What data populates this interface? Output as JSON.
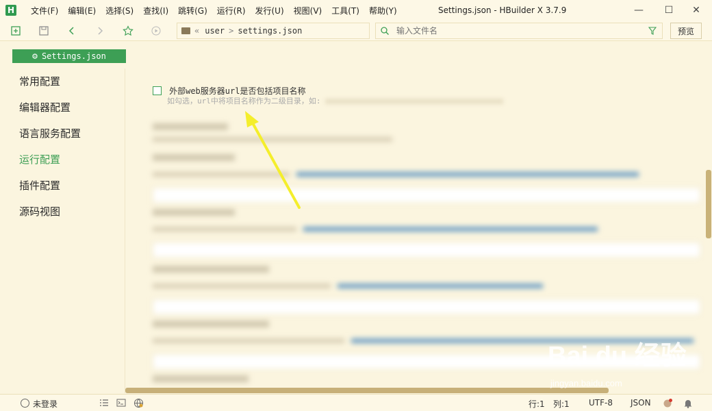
{
  "app": {
    "logo": "H",
    "window_title": "Settings.json - HBuilder X 3.7.9"
  },
  "menu": [
    "文件(F)",
    "编辑(E)",
    "选择(S)",
    "查找(I)",
    "跳转(G)",
    "运行(R)",
    "发行(U)",
    "视图(V)",
    "工具(T)",
    "帮助(Y)"
  ],
  "window_controls": {
    "minimize": "—",
    "maximize": "☐",
    "close": "✕"
  },
  "toolbar": {
    "breadcrumb": {
      "prefix": "«",
      "parts": [
        "user",
        "settings.json"
      ],
      "separator": ">"
    },
    "search_placeholder": "输入文件名",
    "preview_label": "预览"
  },
  "tab": {
    "label": "Settings.json",
    "accent": "#3d9f55"
  },
  "sidebar": {
    "items": [
      {
        "label": "常用配置",
        "active": false
      },
      {
        "label": "编辑器配置",
        "active": false
      },
      {
        "label": "语言服务配置",
        "active": false
      },
      {
        "label": "运行配置",
        "active": true
      },
      {
        "label": "插件配置",
        "active": false
      },
      {
        "label": "源码视图",
        "active": false
      }
    ]
  },
  "main": {
    "option": {
      "label": "外部web服务器url是否包括项目名称",
      "description": "如勾选，url中将项目名称作为二级目录，如:",
      "checked": false
    }
  },
  "statusbar": {
    "login": "未登录",
    "line": "行:1",
    "col": "列:1",
    "encoding": "UTF-8",
    "language": "JSON"
  },
  "watermark": {
    "logo_text": "Bai du 经验",
    "url": "jingyan.baidu.com"
  },
  "colors": {
    "accent": "#3d9f55",
    "background": "#fbf5df",
    "arrow": "#f4ee2c"
  }
}
